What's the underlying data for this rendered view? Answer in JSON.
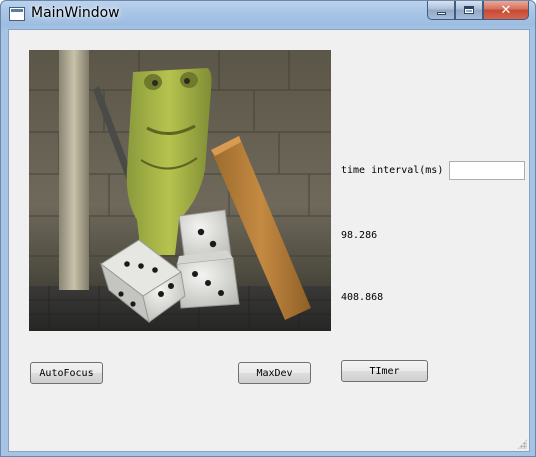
{
  "window": {
    "title": "MainWindow",
    "minimize_icon": "minimize-icon",
    "maximize_icon": "maximize-icon",
    "close_icon": "close-icon",
    "close_glyph": "✕"
  },
  "controls": {
    "interval_label": "time interval(ms)",
    "interval_value": "",
    "value_1": "98.286",
    "value_2": "408.868"
  },
  "buttons": {
    "autofocus": "AutoFocus",
    "maxdev": "MaxDev",
    "timer": "TImer"
  },
  "colors": {
    "client_bg": "#f0f0f0",
    "titlebar": "#a9c6e6",
    "close_button": "#c64a32"
  }
}
